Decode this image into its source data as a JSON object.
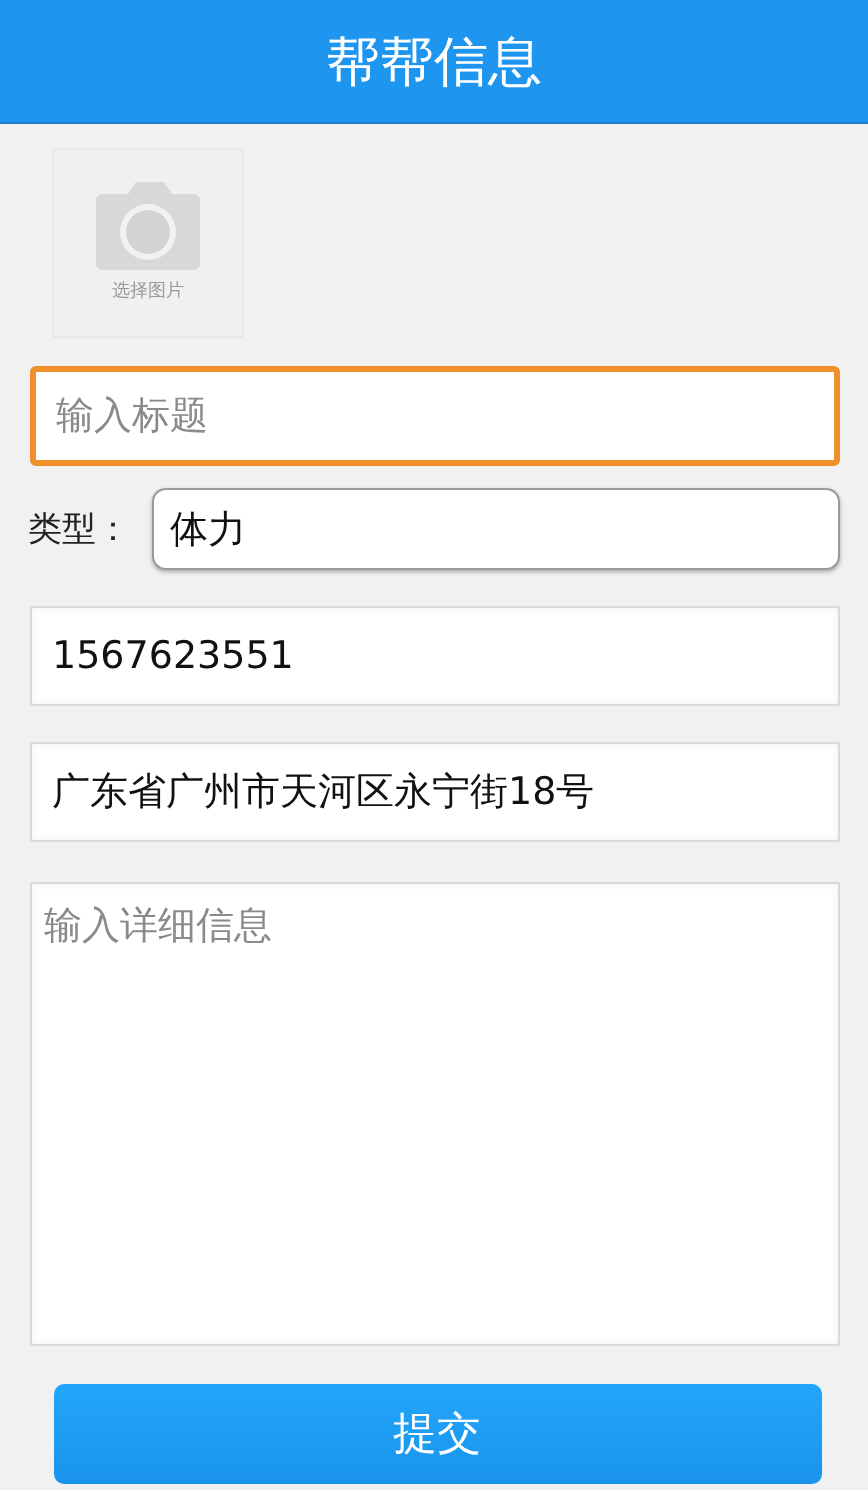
{
  "header": {
    "title": "帮帮信息"
  },
  "image_picker": {
    "label": "选择图片"
  },
  "fields": [
    {
      "kind": "text",
      "placeholder": "输入标题",
      "focused": true
    },
    {
      "kind": "labeled",
      "label": "类型：",
      "value": "体力",
      "focused": false
    },
    {
      "kind": "text",
      "value": "1567623551",
      "focused": false
    },
    {
      "kind": "text",
      "value": "广东省广州市天河区永宁街18号",
      "focused": false
    },
    {
      "kind": "multiline",
      "placeholder": "输入详细信息",
      "focused": false
    }
  ],
  "submit": {
    "label": "提交"
  }
}
